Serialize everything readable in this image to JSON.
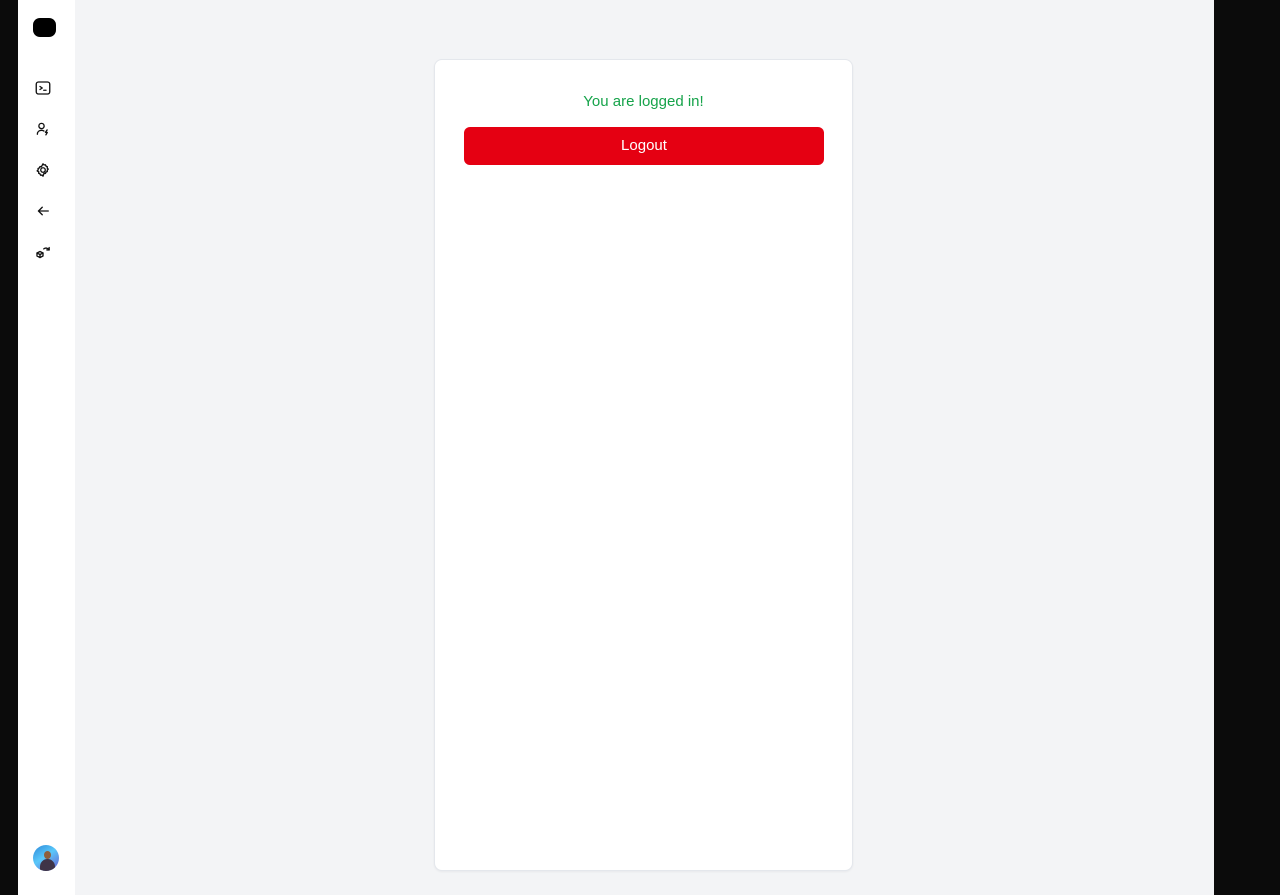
{
  "sidebar": {
    "logo": {
      "icon": "rounded-square-logo",
      "color": "#000000"
    },
    "items": [
      {
        "icon": "terminal-icon"
      },
      {
        "icon": "user-zap-icon"
      },
      {
        "icon": "gear-icon"
      },
      {
        "icon": "arrow-left-icon"
      },
      {
        "icon": "boxes-refresh-icon"
      }
    ],
    "avatar": {
      "icon": "user-avatar"
    }
  },
  "main": {
    "status_message": "You are logged in!",
    "logout_label": "Logout"
  },
  "colors": {
    "background": "#f3f4f6",
    "sidebar": "#ffffff",
    "success": "#16a34a",
    "danger": "#e50012",
    "outer": "#0b0b0b"
  }
}
